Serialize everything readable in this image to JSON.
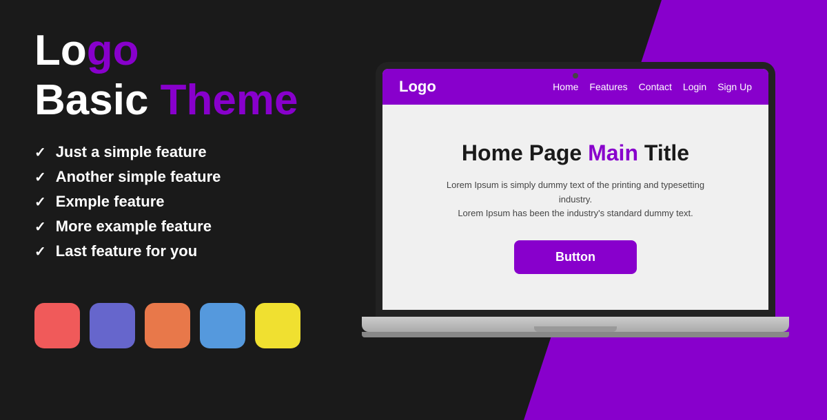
{
  "background": {
    "accent_color": "#8800cc"
  },
  "left_panel": {
    "logo_text_white": "Lo",
    "logo_text_accent": "go",
    "theme_text_white": "Basic ",
    "theme_text_accent": "Theme",
    "features": [
      {
        "id": 1,
        "text": "Just a simple feature"
      },
      {
        "id": 2,
        "text": "Another simple feature"
      },
      {
        "id": 3,
        "text": "Exmple feature"
      },
      {
        "id": 4,
        "text": "More example feature"
      },
      {
        "id": 5,
        "text": "Last feature for you"
      }
    ],
    "swatches": [
      {
        "id": "red",
        "color": "#f05a5a"
      },
      {
        "id": "purple",
        "color": "#6666cc"
      },
      {
        "id": "orange",
        "color": "#e8784a"
      },
      {
        "id": "blue",
        "color": "#5599dd"
      },
      {
        "id": "yellow",
        "color": "#f0e030"
      }
    ]
  },
  "mock_navbar": {
    "logo": "Logo",
    "links": [
      "Home",
      "Features",
      "Contact",
      "Login",
      "Sign Up"
    ]
  },
  "mock_hero": {
    "title_black": "Home Page ",
    "title_accent": "Main",
    "title_black2": " Title",
    "body_text_line1": "Lorem Ipsum is simply dummy text of the printing and typesetting industry.",
    "body_text_line2": "Lorem Ipsum has been the industry's standard dummy text.",
    "button_label": "Button"
  }
}
